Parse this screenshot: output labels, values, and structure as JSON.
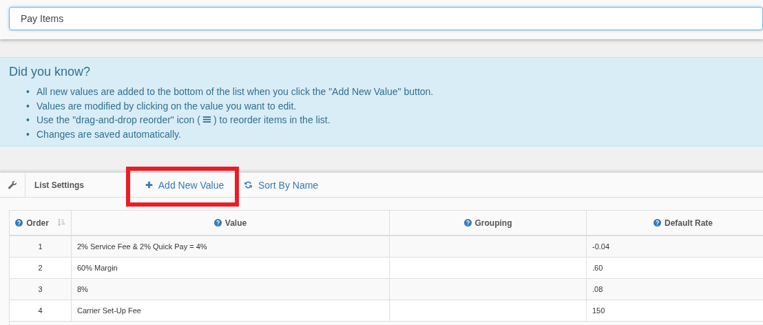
{
  "title_field": {
    "value": "Pay Items"
  },
  "info": {
    "heading": "Did you know?",
    "bullet": "•",
    "items": [
      {
        "kind": "text",
        "text": "All new values are added to the bottom of the list when you click the \"Add New Value\" button."
      },
      {
        "kind": "text",
        "text": "Values are modified by clicking on the value you want to edit."
      },
      {
        "kind": "with_icon",
        "text_before": "Use the \"drag-and-drop reorder\" icon (",
        "text_after": ") to reorder items in the list."
      },
      {
        "kind": "text",
        "text": "Changes are saved automatically."
      }
    ]
  },
  "toolbar": {
    "settings_label": "List Settings",
    "buttons": [
      {
        "kind": "add",
        "label": "Add New Value",
        "highlighted": true
      },
      {
        "kind": "sort",
        "label": "Sort By Name",
        "highlighted": false
      }
    ]
  },
  "table": {
    "columns": [
      {
        "label": "Order",
        "sortable": true
      },
      {
        "label": "Value",
        "sortable": false
      },
      {
        "label": "Grouping",
        "sortable": false
      },
      {
        "label": "Default Rate",
        "sortable": false
      }
    ],
    "rows": [
      [
        "1",
        "2% Service Fee & 2% Quick Pay = 4%",
        "",
        "-0.04"
      ],
      [
        "2",
        "60% Margin",
        "",
        ".60"
      ],
      [
        "3",
        "8%",
        "",
        ".08"
      ],
      [
        "4",
        "Carrier Set-Up Fee",
        "",
        "150"
      ]
    ]
  }
}
